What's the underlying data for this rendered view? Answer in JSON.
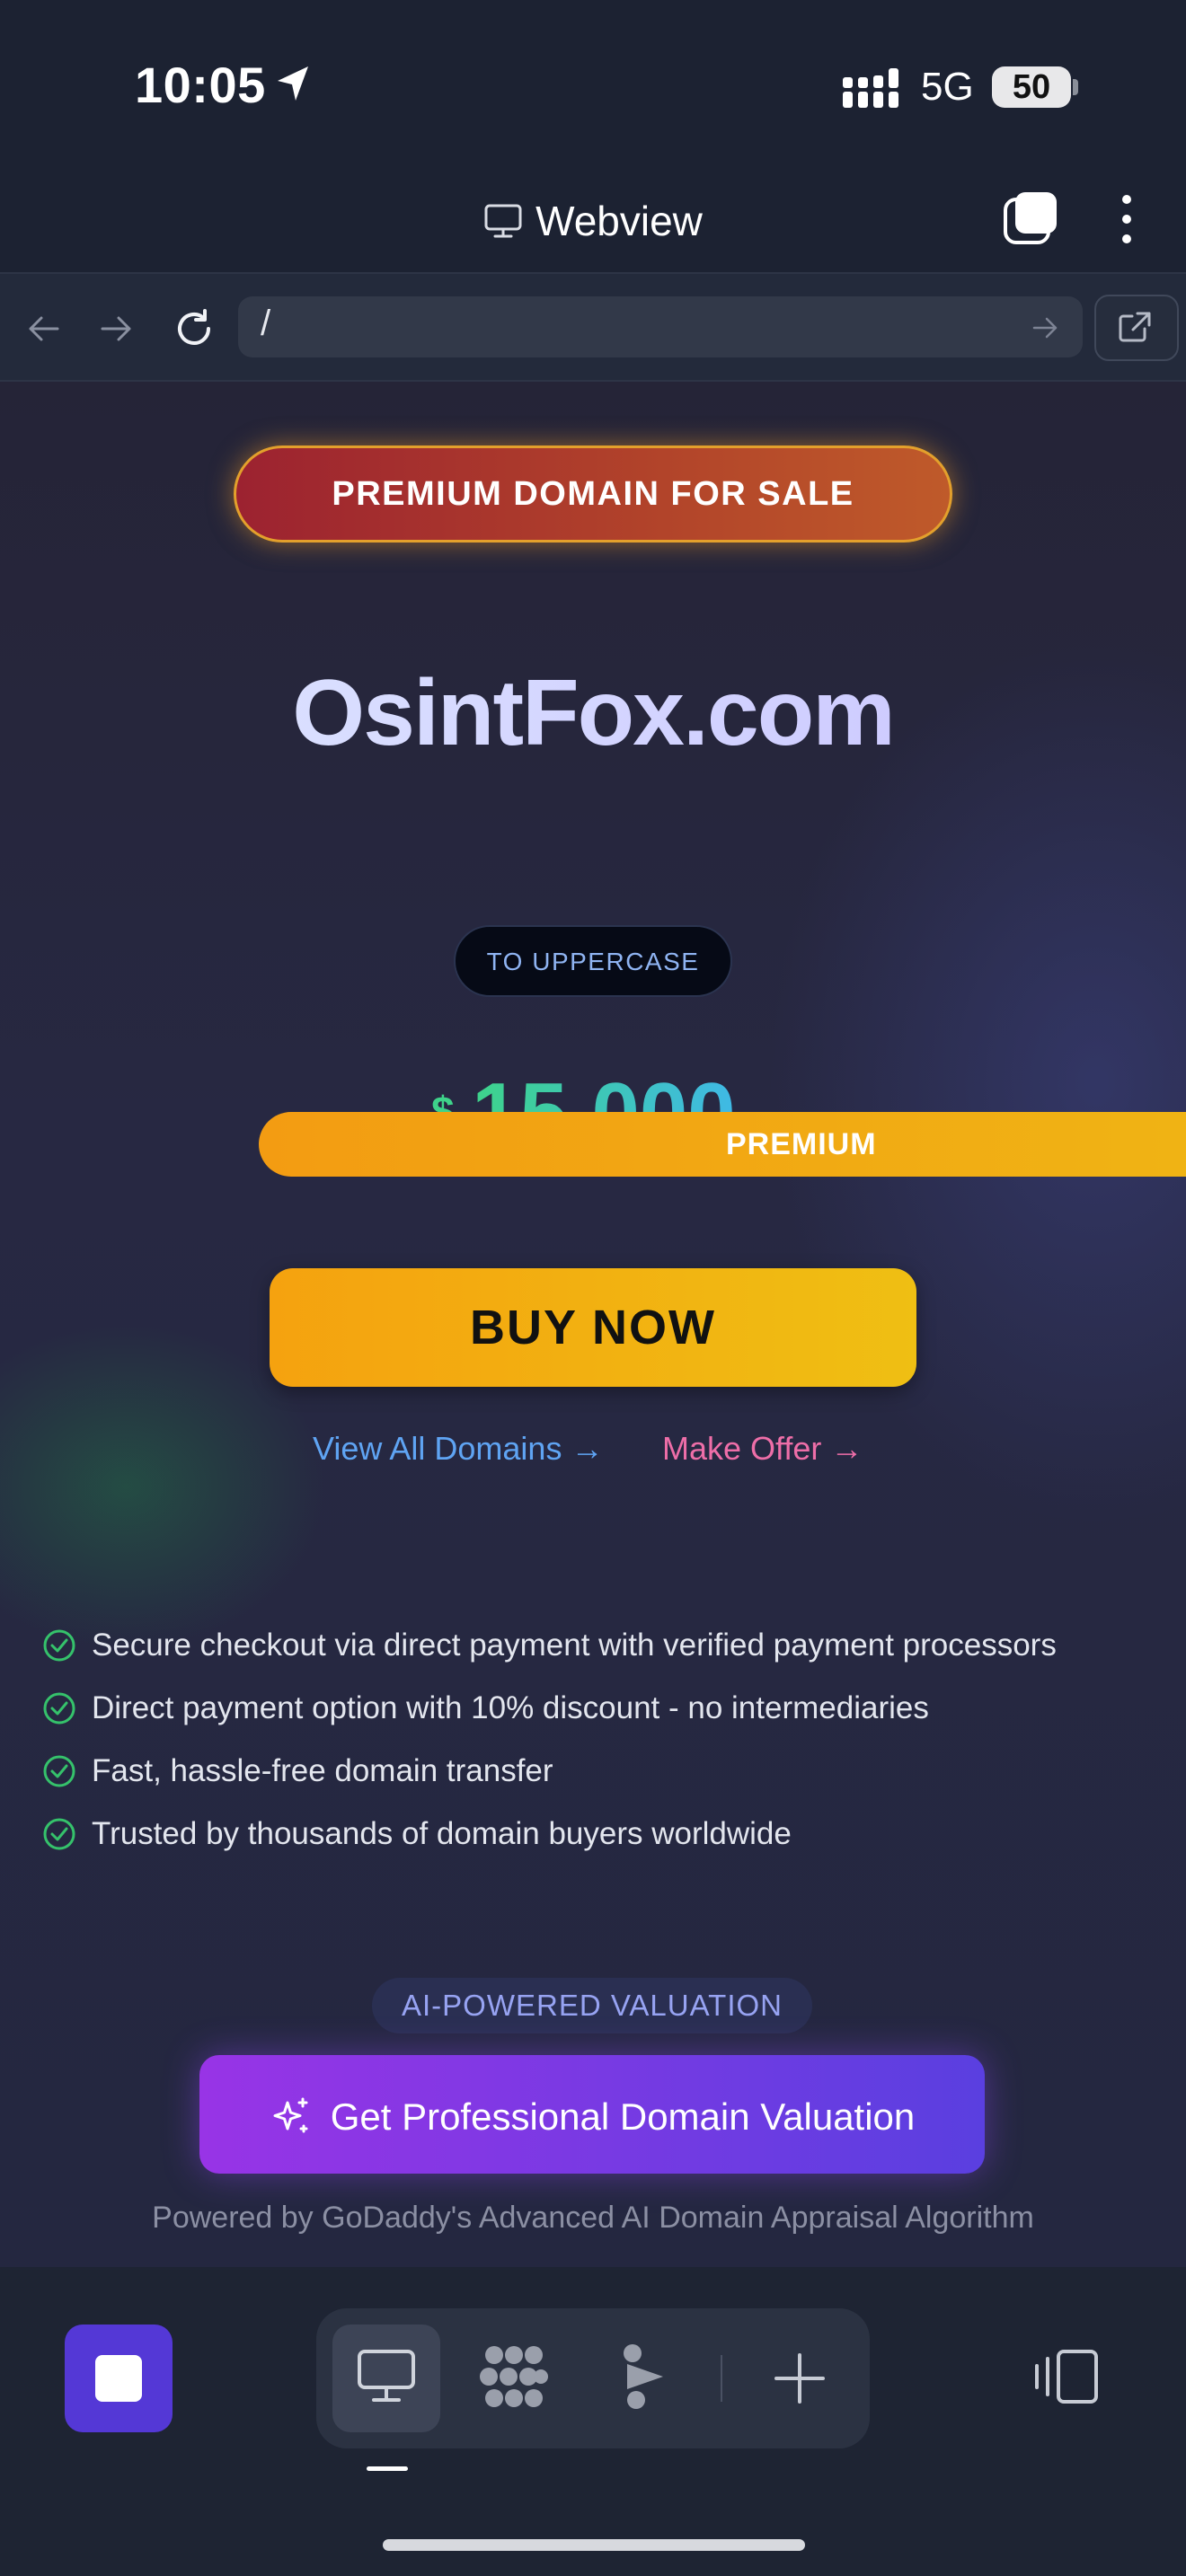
{
  "status_bar": {
    "time": "10:05",
    "network": "5G",
    "battery": "50"
  },
  "header": {
    "title": "Webview"
  },
  "url_bar": {
    "url": "/"
  },
  "hero": {
    "badge": "PREMIUM DOMAIN FOR SALE",
    "domain": "OsintFox.com",
    "uppercase_button": "TO UPPERCASE",
    "price_symbol": "$",
    "price": "15,000",
    "ribbon": "PREMIUM",
    "buy_button": "BUY NOW",
    "view_all_link": "View All Domains →",
    "make_offer_link": "Make Offer →"
  },
  "features": [
    "Secure checkout via direct payment with verified payment processors",
    "Direct payment option with 10% discount - no intermediaries",
    "Fast, hassle-free domain transfer",
    "Trusted by thousands of domain buyers worldwide"
  ],
  "valuation": {
    "badge": "AI-POWERED VALUATION",
    "button": "Get Professional Domain Valuation",
    "powered_by": "Powered by GoDaddy's Advanced AI Domain Appraisal Algorithm"
  },
  "colors": {
    "accent": "#5438d6",
    "buy": "#f5a20f",
    "link_blue": "#5fa4f3",
    "link_pink": "#ee6ea8"
  }
}
